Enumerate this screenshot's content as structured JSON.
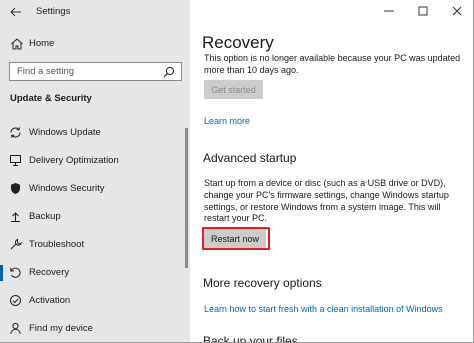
{
  "window": {
    "app_title": "Settings"
  },
  "sidebar": {
    "home_label": "Home",
    "search_placeholder": "Find a setting",
    "section_title": "Update & Security",
    "items": [
      {
        "label": "Windows Update",
        "icon": "sync-icon"
      },
      {
        "label": "Delivery Optimization",
        "icon": "delivery-optimization-icon"
      },
      {
        "label": "Windows Security",
        "icon": "shield-icon"
      },
      {
        "label": "Backup",
        "icon": "backup-icon"
      },
      {
        "label": "Troubleshoot",
        "icon": "wrench-icon"
      },
      {
        "label": "Recovery",
        "icon": "recovery-icon",
        "selected": true
      },
      {
        "label": "Activation",
        "icon": "activation-icon"
      },
      {
        "label": "Find my device",
        "icon": "person-icon"
      }
    ]
  },
  "content": {
    "title": "Recovery",
    "clipped_text": "This option is no longer available because your PC was updated more than 10 days ago.",
    "get_started_label": "Get started",
    "learn_more_label": "Learn more",
    "advanced_startup": {
      "heading": "Advanced startup",
      "description": "Start up from a device or disc (such as a USB drive or DVD), change your PC's firmware settings, change Windows startup settings, or restore Windows from a system image. This will restart your PC.",
      "restart_label": "Restart now"
    },
    "more_recovery": {
      "heading": "More recovery options",
      "link": "Learn how to start fresh with a clean installation of Windows"
    },
    "next_heading_clipped": "Back up your files"
  },
  "colors": {
    "accent": "#0063b1",
    "link": "#0067b8",
    "highlight_border": "#e02020",
    "sidebar_bg": "#e6e6e6"
  }
}
